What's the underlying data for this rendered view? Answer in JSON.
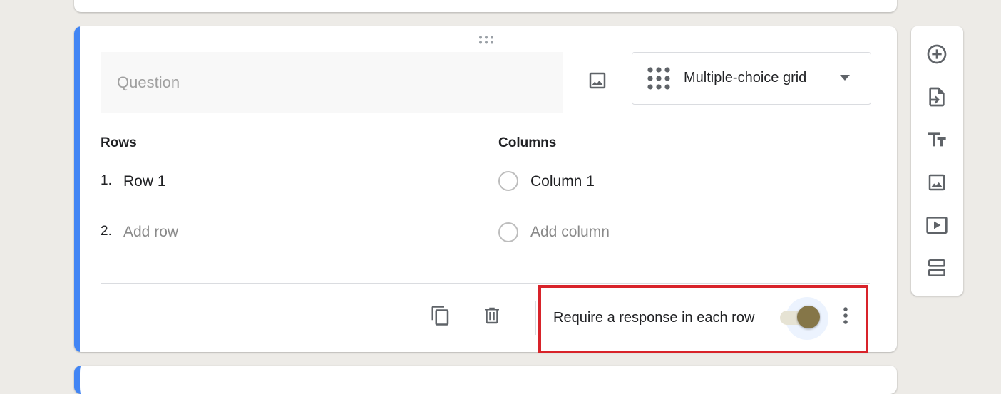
{
  "question": {
    "placeholder": "Question",
    "type_label": "Multiple-choice grid"
  },
  "rows": {
    "title": "Rows",
    "items": [
      {
        "num": "1.",
        "label": "Row 1"
      }
    ],
    "add": {
      "num": "2.",
      "label": "Add row"
    }
  },
  "columns": {
    "title": "Columns",
    "items": [
      {
        "label": "Column 1"
      }
    ],
    "add": {
      "label": "Add column"
    }
  },
  "footer": {
    "require_label": "Require a response in each row",
    "require_on": true
  },
  "icons": {
    "question_image": "image-icon",
    "type_select": "grid-icon",
    "copy": "copy-icon",
    "delete": "trash-icon",
    "more": "more-vert-icon",
    "sidebar": [
      "add-circle-icon",
      "import-icon",
      "title-icon",
      "image-icon",
      "video-icon",
      "section-icon"
    ]
  },
  "colors": {
    "accent": "#4285f4",
    "toggle_thumb": "#857648",
    "toggle_track": "#e6e3d4",
    "highlight": "#d8232a"
  }
}
